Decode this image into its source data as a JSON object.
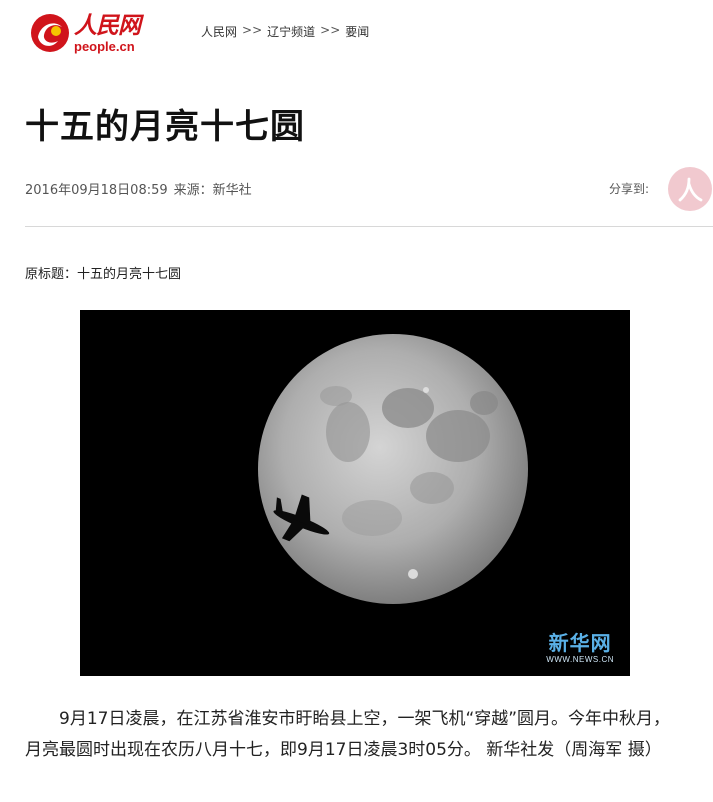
{
  "site": {
    "logo_cn": "人民网",
    "logo_en": "people.cn",
    "brand_color": "#d0141b"
  },
  "breadcrumb": {
    "items": [
      "人民网",
      "辽宁频道",
      "要闻"
    ],
    "separator": ">>"
  },
  "article": {
    "title": "十五的月亮十七圆",
    "date": "2016年09月18日08:59",
    "source": "来源：新华社",
    "original_title": "原标题：十五的月亮十七圆",
    "body": "9月17日凌晨，在江苏省淮安市盱眙县上空，一架飞机“穿越”圆月。今年中秋月，月亮最圆时出现在农历八月十七，即9月17日凌晨3时05分。 新华社发（周海军 摄）"
  },
  "share": {
    "label": "分享到:",
    "icon": "people-daily-share-icon"
  },
  "photo": {
    "watermark_cn": "新华网",
    "watermark_en": "WWW.NEWS.CN",
    "subject": "moon-airplane-photo"
  }
}
